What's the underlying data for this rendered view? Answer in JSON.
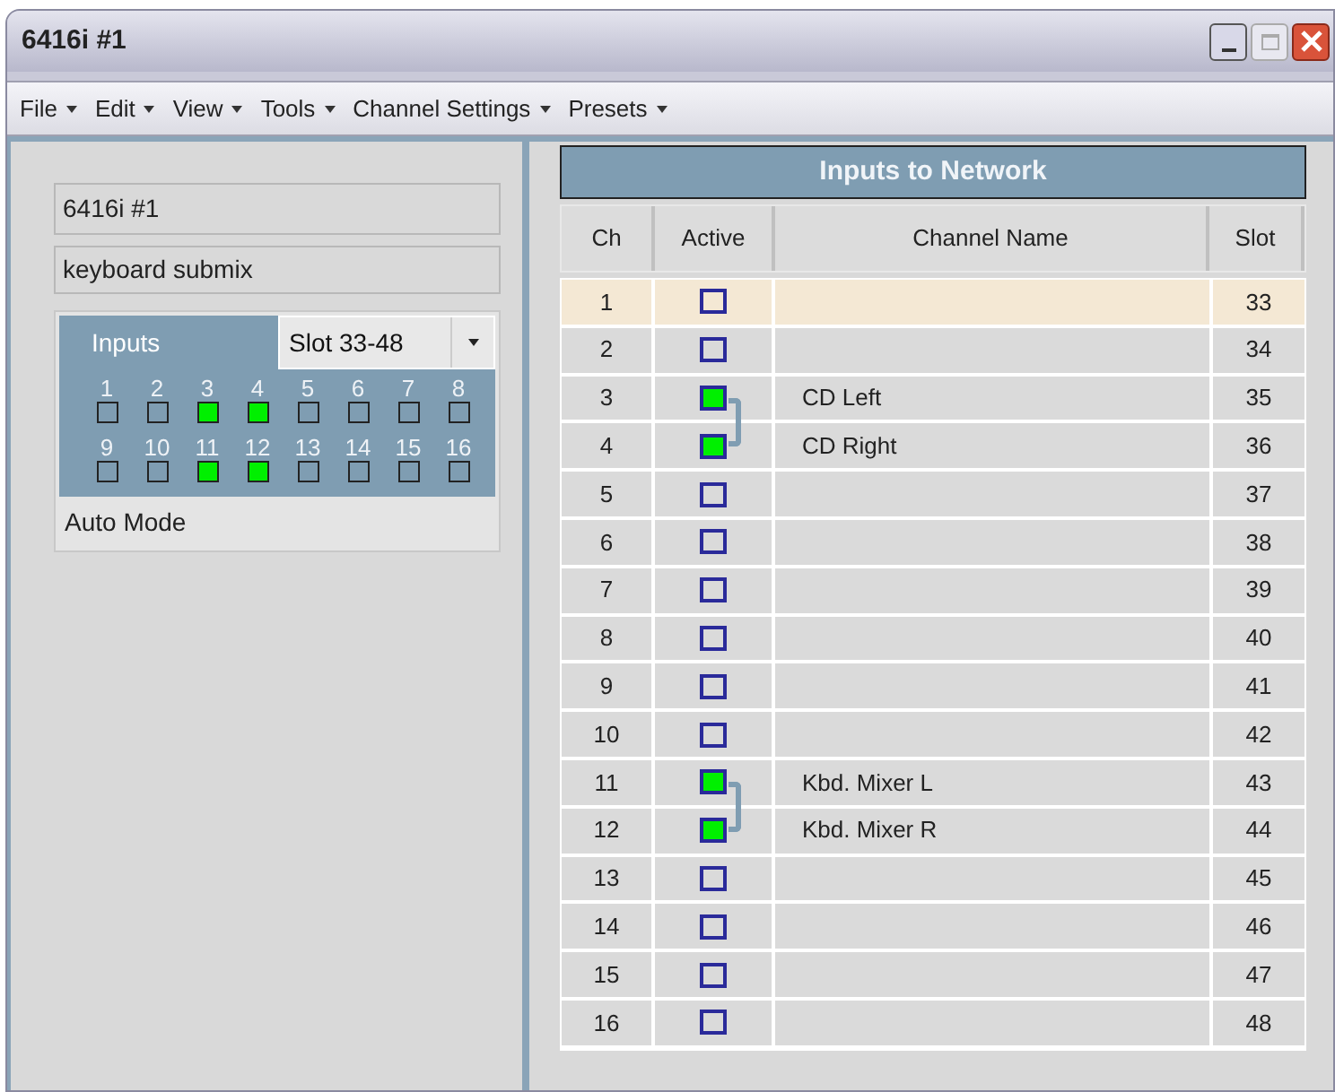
{
  "window": {
    "title": "6416i #1"
  },
  "menu": [
    {
      "label": "File"
    },
    {
      "label": "Edit"
    },
    {
      "label": "View"
    },
    {
      "label": "Tools"
    },
    {
      "label": "Channel Settings"
    },
    {
      "label": "Presets"
    }
  ],
  "device": {
    "name": "6416i #1",
    "description": "keyboard submix",
    "inputs_label": "Inputs",
    "slot_select": "Slot 33-48",
    "mode": "Auto Mode"
  },
  "inputs": [
    {
      "label": "1",
      "on": false
    },
    {
      "label": "2",
      "on": false
    },
    {
      "label": "3",
      "on": true
    },
    {
      "label": "4",
      "on": true
    },
    {
      "label": "5",
      "on": false
    },
    {
      "label": "6",
      "on": false
    },
    {
      "label": "7",
      "on": false
    },
    {
      "label": "8",
      "on": false
    },
    {
      "label": "9",
      "on": false
    },
    {
      "label": "10",
      "on": false
    },
    {
      "label": "11",
      "on": true
    },
    {
      "label": "12",
      "on": true
    },
    {
      "label": "13",
      "on": false
    },
    {
      "label": "14",
      "on": false
    },
    {
      "label": "15",
      "on": false
    },
    {
      "label": "16",
      "on": false
    }
  ],
  "table": {
    "title": "Inputs to Network",
    "columns": [
      "Ch",
      "Active",
      "Channel Name",
      "Slot"
    ],
    "rows": [
      {
        "ch": "1",
        "active": false,
        "slot": "33",
        "selected": true
      },
      {
        "ch": "2",
        "active": false,
        "slot": "34",
        "selected": false
      },
      {
        "ch": "3",
        "active": true,
        "name": "CD Left",
        "slot": "35",
        "selected": false,
        "link_down": true
      },
      {
        "ch": "4",
        "active": true,
        "name": "CD Right",
        "slot": "36",
        "selected": false,
        "link_up": true
      },
      {
        "ch": "5",
        "active": false,
        "slot": "37",
        "selected": false
      },
      {
        "ch": "6",
        "active": false,
        "slot": "38",
        "selected": false
      },
      {
        "ch": "7",
        "active": false,
        "slot": "39",
        "selected": false
      },
      {
        "ch": "8",
        "active": false,
        "slot": "40",
        "selected": false
      },
      {
        "ch": "9",
        "active": false,
        "slot": "41",
        "selected": false
      },
      {
        "ch": "10",
        "active": false,
        "slot": "42",
        "selected": false
      },
      {
        "ch": "11",
        "active": true,
        "name": "Kbd. Mixer L",
        "slot": "43",
        "selected": false,
        "link_down": true
      },
      {
        "ch": "12",
        "active": true,
        "name": "Kbd. Mixer R",
        "slot": "44",
        "selected": false,
        "link_up": true
      },
      {
        "ch": "13",
        "active": false,
        "slot": "45",
        "selected": false
      },
      {
        "ch": "14",
        "active": false,
        "slot": "46",
        "selected": false
      },
      {
        "ch": "15",
        "active": false,
        "slot": "47",
        "selected": false
      },
      {
        "ch": "16",
        "active": false,
        "slot": "48",
        "selected": false
      }
    ]
  }
}
